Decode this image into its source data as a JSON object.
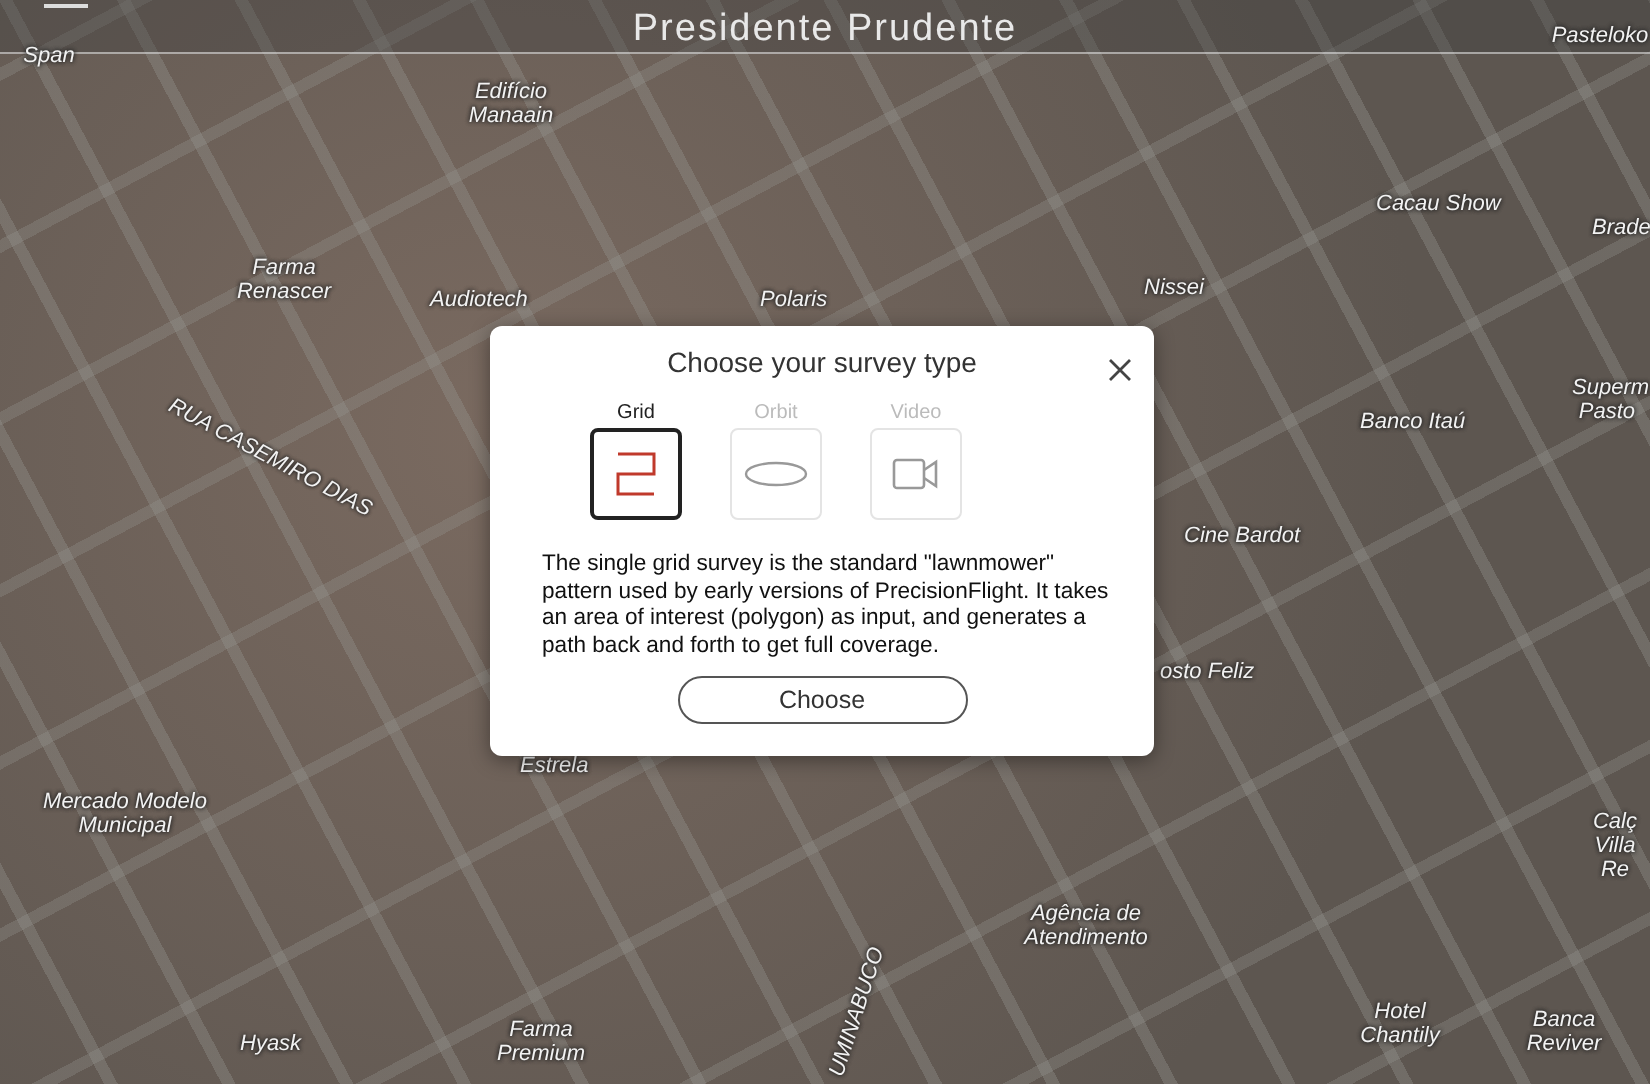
{
  "header": {
    "title": "Presidente Prudente"
  },
  "map": {
    "labels": [
      {
        "text": "Span"
      },
      {
        "text": "Pasteloko"
      },
      {
        "text": "Edifício Manaain"
      },
      {
        "text": "Cacau Show"
      },
      {
        "text": "Brade"
      },
      {
        "text": "Farma Renascer"
      },
      {
        "text": "Audiotech"
      },
      {
        "text": "Polaris"
      },
      {
        "text": "Nissei"
      },
      {
        "text": "Superm Pasto"
      },
      {
        "text": "Banco Itaú"
      },
      {
        "text": "RUA CASEMIRO DIAS"
      },
      {
        "text": "Cine Bardot"
      },
      {
        "text": "osto Feliz"
      },
      {
        "text": "Estrela"
      },
      {
        "text": "Mercado Modelo Municipal"
      },
      {
        "text": "Calç Villa Re"
      },
      {
        "text": "Agência de Atendimento"
      },
      {
        "text": "UMINABUCO"
      },
      {
        "text": "Hyask"
      },
      {
        "text": "Farma Premium"
      },
      {
        "text": "Hotel Chantily"
      },
      {
        "text": "Banca Reviver"
      }
    ]
  },
  "dialog": {
    "title": "Choose your survey type",
    "types": [
      {
        "kind": "grid",
        "label": "Grid",
        "selected": true
      },
      {
        "kind": "orbit",
        "label": "Orbit",
        "selected": false
      },
      {
        "kind": "video",
        "label": "Video",
        "selected": false
      }
    ],
    "description": "The single grid survey is the standard \"lawnmower\" pattern used by early versions of PrecisionFlight. It takes an area of interest (polygon) as input, and generates a path back and forth to get full coverage.",
    "button": "Choose"
  }
}
